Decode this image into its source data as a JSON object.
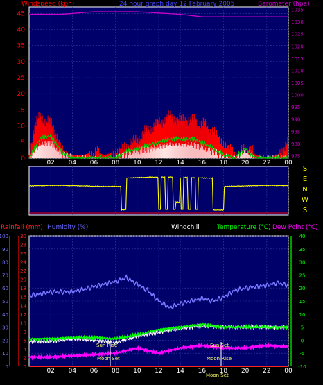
{
  "top_panel": {
    "title": "24 hour graph day  12 February 2005",
    "left_axis_title": "Windspeed (kph)",
    "right_axis_title": "Barometer (hpa)"
  },
  "wind_dir_panel": {
    "letters": [
      "S",
      "E",
      "N",
      "W",
      "S"
    ]
  },
  "bottom_panel": {
    "rain_title": "Rainfall (mm)",
    "humidity_title": "Humidity (%)",
    "windchill_title": "Windchill",
    "temperature_title": "Temperature (°C)",
    "dewpoint_title": "Dew Point (°C)",
    "events": {
      "sun_rise": "Sun Rise",
      "moon_set_1": "Moon Set",
      "sun_set": "Sun Set",
      "moon_rise": "Moon Rise",
      "moon_set_2": "Moon Set"
    }
  },
  "colors": {
    "wind": "#ff0000",
    "gust": "#00cc00",
    "barometer": "#cc00cc",
    "wind_dir": "#ffff00",
    "humidity": "#7777ff",
    "temperature": "#00ff00",
    "dewpoint": "#ff00ff",
    "windchill": "#ffffff",
    "rain": "#ff2222",
    "rain_axis": "#cc0000",
    "humidity_axis": "#4444ff",
    "temp_axis": "#00cc00"
  },
  "chart_data": [
    {
      "type": "bar",
      "x_ticks": [
        "02",
        "04",
        "06",
        "08",
        "10",
        "12",
        "14",
        "16",
        "18",
        "20",
        "22",
        "00"
      ],
      "left_axis": {
        "label": "Windspeed (kph)",
        "ticks": [
          0,
          5,
          10,
          15,
          20,
          25,
          30,
          35,
          40,
          45
        ],
        "ylim": [
          0,
          47
        ]
      },
      "right_axis": {
        "label": "Barometer (hpa)",
        "ticks": [
          975,
          980,
          985,
          990,
          995,
          1000,
          1005,
          1010,
          1015,
          1020,
          1025,
          1030,
          1035
        ],
        "ylim": [
          974,
          1036
        ]
      },
      "series": [
        {
          "name": "Windspeed",
          "axis": "left",
          "x": [
            0,
            0.5,
            1,
            1.5,
            2,
            2.5,
            3,
            4,
            5,
            6,
            7,
            8,
            9,
            10,
            11,
            12,
            13,
            14,
            15,
            16,
            17,
            18,
            19,
            19.5,
            20,
            21,
            22,
            23,
            23.5,
            24
          ],
          "values": [
            1,
            10,
            13,
            12,
            11,
            8,
            2,
            1,
            1,
            2,
            1,
            2,
            4,
            6,
            9,
            11,
            13,
            12,
            12,
            11,
            9,
            5,
            2,
            1,
            4,
            1,
            0,
            1,
            3,
            5
          ]
        },
        {
          "name": "Gust",
          "axis": "left",
          "x": [
            0,
            1,
            2,
            3,
            4,
            8,
            9,
            10,
            11,
            12,
            13,
            14,
            15,
            16,
            17,
            18,
            19,
            20,
            21,
            24
          ],
          "values": [
            0,
            6,
            7,
            2,
            0,
            0,
            2,
            3,
            4,
            5,
            6,
            6,
            6,
            5,
            3,
            1,
            0,
            3,
            0,
            0
          ]
        },
        {
          "name": "Barometer",
          "axis": "right",
          "x": [
            0,
            3,
            6,
            8,
            10,
            12,
            14,
            16,
            18,
            20,
            22,
            24
          ],
          "values": [
            1033,
            1033,
            1034,
            1034,
            1034,
            1033.5,
            1033,
            1032,
            1032,
            1032,
            1032,
            1032
          ]
        }
      ]
    },
    {
      "type": "line",
      "series": [
        {
          "name": "Wind Direction",
          "x": [
            0,
            1.5,
            2,
            8.5,
            9,
            9.5,
            10,
            12,
            13.5,
            14,
            16,
            17,
            18,
            19,
            24
          ],
          "values": [
            "E",
            "E",
            "E",
            "S",
            "N",
            "N",
            "N",
            "N",
            "W",
            "N",
            "N",
            "S",
            "E",
            "E",
            "E"
          ]
        }
      ]
    },
    {
      "type": "line",
      "x_ticks": [
        "02",
        "04",
        "06",
        "08",
        "10",
        "12",
        "14",
        "16",
        "18",
        "20",
        "22",
        "00"
      ],
      "axes": {
        "rainfall_mm": {
          "ticks": [
            0,
            2,
            4,
            6,
            8,
            10,
            12,
            14,
            16,
            18,
            20,
            22,
            24,
            26,
            28,
            30
          ],
          "ylim": [
            0,
            30
          ]
        },
        "humidity_pct": {
          "ticks": [
            0,
            10,
            20,
            30,
            40,
            50,
            60,
            70,
            80,
            90,
            100
          ],
          "ylim": [
            0,
            100
          ]
        },
        "temperature_c": {
          "ticks": [
            -10,
            -5,
            0,
            5,
            10,
            15,
            20,
            25,
            30,
            35,
            40
          ],
          "ylim": [
            -10,
            40
          ]
        }
      },
      "series": [
        {
          "name": "Humidity",
          "axis": "humidity_pct",
          "x": [
            0,
            2,
            4,
            6,
            7,
            8,
            9,
            10,
            11,
            12,
            13,
            14,
            15,
            16,
            17,
            18,
            19,
            20,
            21,
            22,
            23,
            24
          ],
          "values": [
            54,
            57,
            57,
            61,
            63,
            65,
            68,
            63,
            58,
            50,
            45,
            48,
            50,
            52,
            50,
            53,
            58,
            60,
            61,
            62,
            64,
            62
          ]
        },
        {
          "name": "Temperature",
          "axis": "temperature_c",
          "x": [
            0,
            2,
            4,
            6,
            8,
            10,
            12,
            14,
            16,
            18,
            20,
            22,
            24
          ],
          "values": [
            0.5,
            0.5,
            1,
            1,
            0.5,
            2,
            4,
            5,
            6,
            5,
            5,
            5,
            5
          ]
        },
        {
          "name": "Windchill",
          "axis": "temperature_c",
          "x": [
            0,
            2,
            4,
            6,
            8,
            10,
            12,
            14,
            16,
            18,
            20,
            22,
            24
          ],
          "values": [
            -0.5,
            -0.5,
            0.5,
            0,
            -1,
            1.5,
            3,
            4.5,
            5.5,
            5,
            5,
            5,
            5
          ]
        },
        {
          "name": "Dew Point",
          "axis": "temperature_c",
          "x": [
            0,
            2,
            4,
            6,
            8,
            10,
            12,
            13,
            14,
            16,
            18,
            20,
            22,
            24
          ],
          "values": [
            -6.5,
            -6.5,
            -6,
            -5.5,
            -5,
            -3,
            -5,
            -4,
            -3,
            -2,
            -3,
            -3,
            -2,
            -2.5
          ]
        },
        {
          "name": "Rainfall",
          "axis": "rainfall_mm",
          "x": [
            0,
            24
          ],
          "values": [
            0,
            0
          ]
        }
      ]
    }
  ]
}
